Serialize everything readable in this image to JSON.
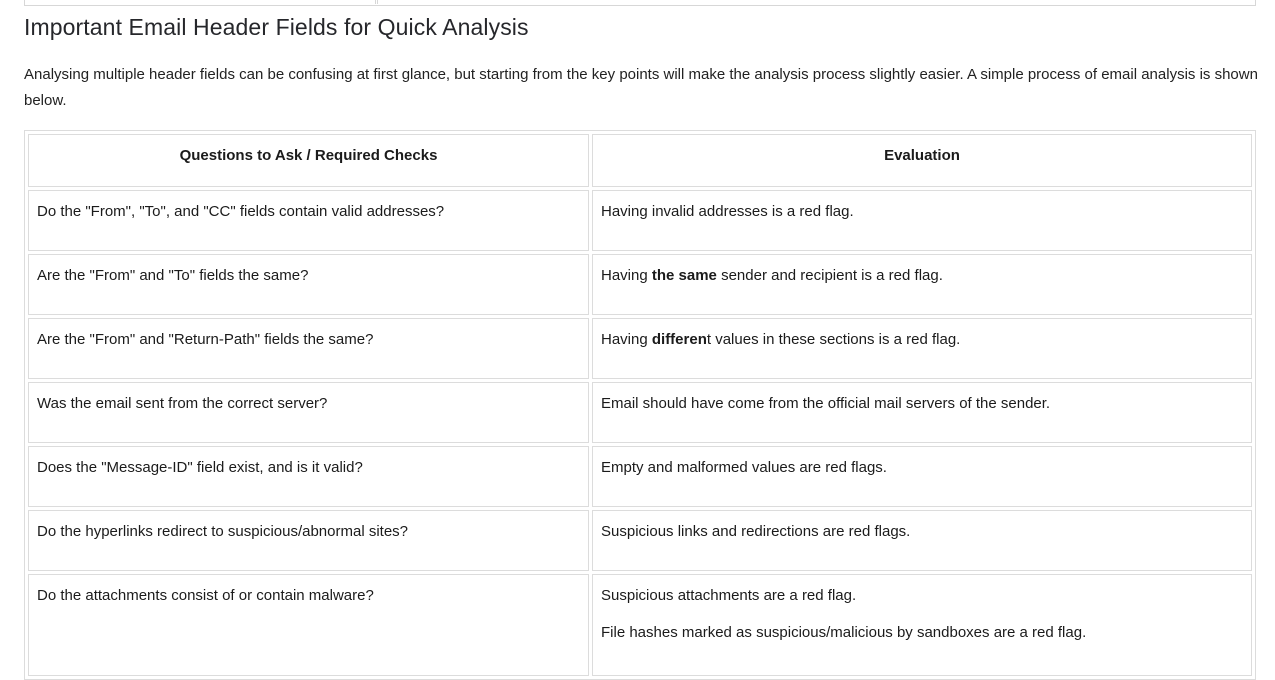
{
  "heading": "Important Email Header Fields for Quick Analysis",
  "intro": "Analysing multiple header fields can be confusing at first glance, but starting from the key points will make the analysis process slightly easier. A simple process of email analysis is shown below.",
  "table": {
    "headers": [
      "Questions to Ask / Required Checks",
      "Evaluation"
    ],
    "rows": [
      {
        "question": "Do the \"From\", \"To\", and \"CC\" fields contain valid addresses?",
        "eval_pre": "Having invalid addresses is a red flag.",
        "eval_bold": "",
        "eval_post": ""
      },
      {
        "question": "Are the \"From\" and \"To\" fields the same?",
        "eval_pre": "Having ",
        "eval_bold": "the same",
        "eval_post": " sender and recipient is a red flag."
      },
      {
        "question": "Are the \"From\" and \"Return-Path\" fields the same?",
        "eval_pre": "Having ",
        "eval_bold": "differen",
        "eval_post": "t values in these sections is a red flag."
      },
      {
        "question": "Was the email sent from the correct server?",
        "eval_pre": "Email should have come from the official mail servers of the sender.",
        "eval_bold": "",
        "eval_post": ""
      },
      {
        "question": "Does the \"Message-ID\" field exist, and is it valid?",
        "eval_pre": "Empty and malformed values are red flags.",
        "eval_bold": "",
        "eval_post": ""
      },
      {
        "question": "Do the hyperlinks redirect to suspicious/abnormal sites?",
        "eval_pre": "Suspicious links and redirections are red flags.",
        "eval_bold": "",
        "eval_post": ""
      },
      {
        "question": "Do the attachments consist of or contain malware?",
        "eval_pre": "Suspicious attachments are a red flag.",
        "eval_bold": "",
        "eval_post": "",
        "eval_line2": "File hashes marked as suspicious/malicious by sandboxes are a red flag."
      }
    ]
  }
}
